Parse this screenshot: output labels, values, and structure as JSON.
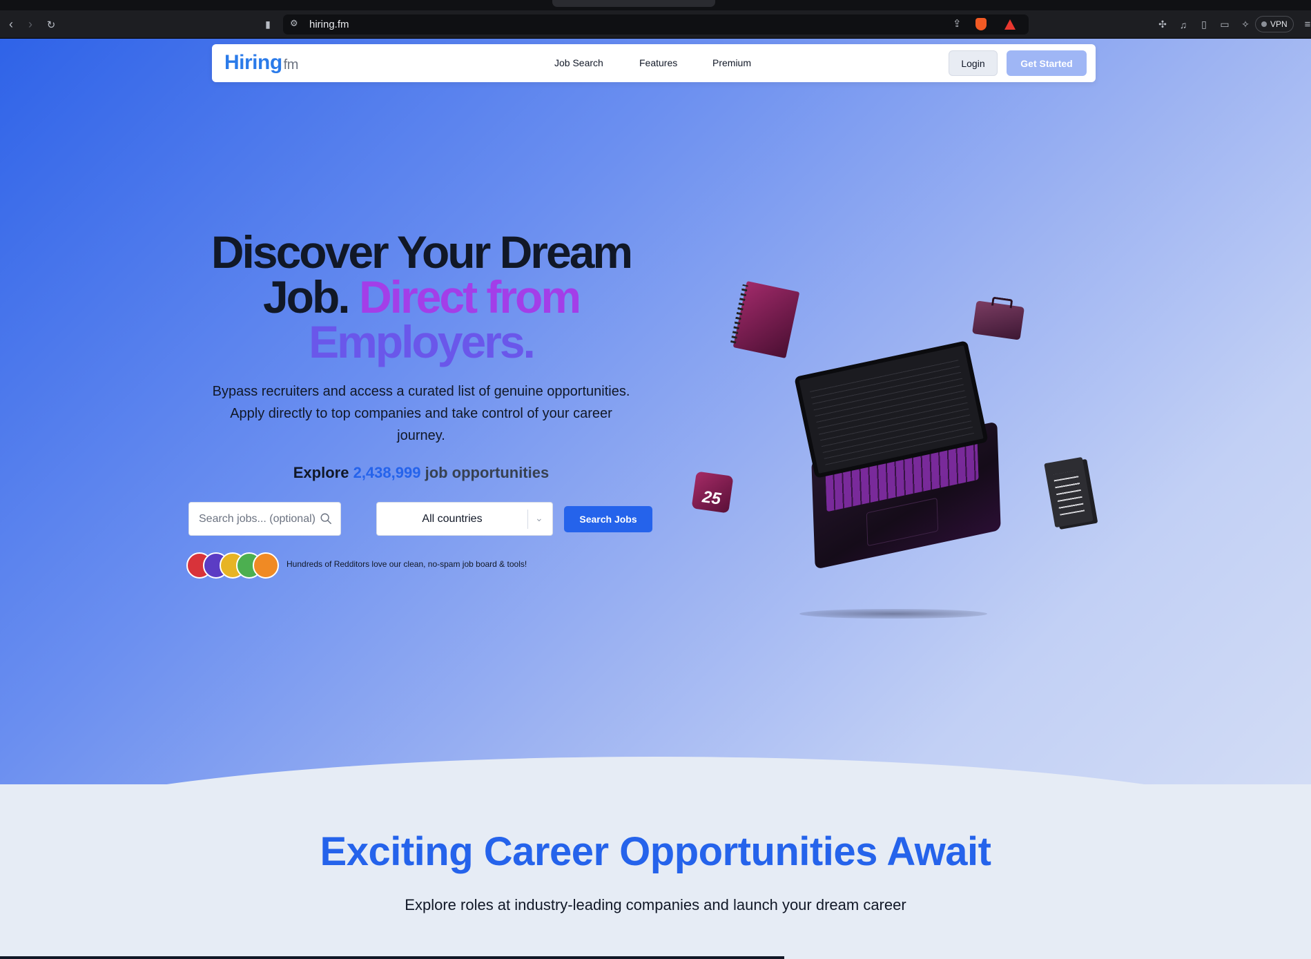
{
  "browser": {
    "url": "hiring.fm",
    "vpn_label": "VPN",
    "back_icon": "chevron-left-icon",
    "forward_icon": "chevron-right-icon",
    "reload_icon": "reload-icon"
  },
  "navbar": {
    "logo_main": "Hiring",
    "logo_suffix": "fm",
    "links": [
      "Job Search",
      "Features",
      "Premium"
    ],
    "login_label": "Login",
    "get_started_label": "Get Started"
  },
  "hero": {
    "headline_1": "Discover Your Dream",
    "headline_2": "Job.",
    "headline_3": "Direct from",
    "headline_4": "Employers.",
    "subtext": "Bypass recruiters and access a curated list of genuine opportunities. Apply directly to top companies and take control of your career journey.",
    "explore_prefix": "Explore",
    "explore_count": "2,438,999",
    "explore_suffix": "job opportunities",
    "search_placeholder": "Search jobs... (optional)",
    "country_value": "All countries",
    "search_button": "Search Jobs",
    "social_proof": "Hundreds of Redditors love our clean, no-spam job board & tools!",
    "calendar_day": "25"
  },
  "section": {
    "title": "Exciting Career Opportunities Await",
    "subtitle": "Explore roles at industry-leading companies and launch your dream career"
  },
  "colors": {
    "primary": "#2563eb",
    "accent_purple": "#a33ee8",
    "logo_blue": "#2b7be9"
  }
}
